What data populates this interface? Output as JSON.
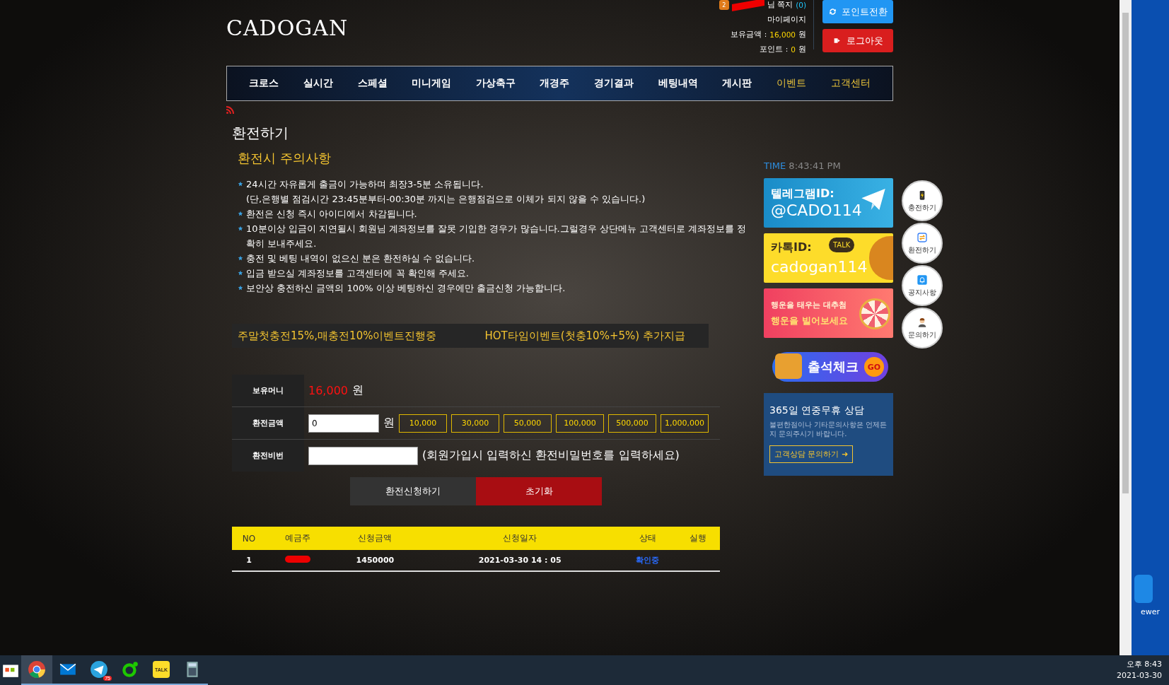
{
  "header": {
    "logo": "CADOGAN",
    "user": {
      "level": "2",
      "suffix": "님 쪽지",
      "messages": "(0)"
    },
    "mypage": "마이페이지",
    "balance": {
      "label": "보유금액 : ",
      "value": "16,000",
      "unit": "원"
    },
    "points": {
      "label": "포인트 : ",
      "value": "0",
      "unit": "원"
    },
    "buttons": [
      {
        "kind": "convert",
        "label": "포인트전환"
      },
      {
        "kind": "logout",
        "label": "로그아웃"
      }
    ]
  },
  "nav": [
    {
      "label": "크로스",
      "highlighted": false
    },
    {
      "label": "실시간",
      "highlighted": false
    },
    {
      "label": "스페셜",
      "highlighted": false
    },
    {
      "label": "미니게임",
      "highlighted": false
    },
    {
      "label": "가상축구",
      "highlighted": false
    },
    {
      "label": "개경주",
      "highlighted": false
    },
    {
      "label": "경기결과",
      "highlighted": false
    },
    {
      "label": "베팅내역",
      "highlighted": false
    },
    {
      "label": "게시판",
      "highlighted": false
    },
    {
      "label": "이벤트",
      "highlighted": true
    },
    {
      "label": "고객센터",
      "highlighted": true
    }
  ],
  "page_title": "환전하기",
  "notice_title": "환전시 주의사항",
  "notices": [
    {
      "text": "24시간 자유롭게 출금이 가능하며 최장3-5분 소유됩니다.",
      "starred": true
    },
    {
      "text": "(단,은행별 점검시간 23:45분부터-00:30분 까지는 은행점검으로 이체가 되지 않을 수 있습니다.)",
      "starred": false
    },
    {
      "text": "환전은 신청 즉시 아이디에서 차감됩니다.",
      "starred": true
    },
    {
      "text": "10분이상 입금이 지연될시 회원님 계좌정보를 잘못 기입한 경우가 많습니다.그럴경우 상단메뉴 고객센터로 계좌정보를 정확히 보내주세요.",
      "starred": true
    },
    {
      "text": "충전 및 베팅 내역이 없으신 분은 환전하실 수 없습니다.",
      "starred": true
    },
    {
      "text": "입금 받으실 계좌정보를 고객센터에 꼭 확인해 주세요.",
      "starred": true
    },
    {
      "text": "보안상 충전하신 금액의 100% 이상 베팅하신 경우에만 출금신청 가능합니다.",
      "starred": true
    }
  ],
  "ticker": [
    "주말첫충전15%,매충전10%이벤트진행중",
    "HOT타임이벤트(첫충10%+5%) 추가지급"
  ],
  "form": {
    "balance": {
      "label": "보유머니",
      "value": "16,000",
      "unit": "원"
    },
    "amount": {
      "label": "환전금액",
      "value": "0",
      "unit": "원",
      "quick": [
        "10,000",
        "30,000",
        "50,000",
        "100,000",
        "500,000",
        "1,000,000"
      ]
    },
    "password": {
      "label": "환전비번",
      "hint": "(회원가입시 입력하신 환전비밀번호를 입력하세요)"
    },
    "submit": "환전신청하기",
    "reset": "초기화"
  },
  "table": {
    "columns": [
      "NO",
      "예금주",
      "신청금액",
      "신청일자",
      "상태",
      "실행"
    ],
    "rows": [
      {
        "no": "1",
        "amount": "1450000",
        "date": "2021-03-30 14 : 05",
        "status": "확인중"
      }
    ]
  },
  "sidebar": {
    "time_label": "TIME",
    "time": "8:43:41 PM",
    "telegram": {
      "title": "텔레그램ID:",
      "id": "@CADO114"
    },
    "kakao": {
      "title": "카톡ID:",
      "badge": "TALK",
      "id": "cadogan114"
    },
    "lottery": {
      "line1": "행운을 태우는 대추첨",
      "line2": "행운을 빌어보세요"
    },
    "attendance": {
      "label": "출석체크",
      "go": "GO"
    },
    "consult": {
      "title": "365일 연중무휴 상담",
      "desc": "불편한점이나 기타문의사항은 언제든지 문의주시기 바랍니다.",
      "link": "고객상담 문의하기 ➜"
    }
  },
  "quick_menu": [
    {
      "kind": "charge",
      "label": "충전하기"
    },
    {
      "kind": "exchange",
      "label": "환전하기"
    },
    {
      "kind": "notice",
      "label": "공지사항"
    },
    {
      "kind": "inquiry",
      "label": "문의하기"
    }
  ],
  "desktop": {
    "label": "ewer"
  },
  "taskbar": {
    "apps": [
      {
        "kind": "store",
        "selected": false
      },
      {
        "kind": "chrome",
        "selected": true
      },
      {
        "kind": "mail",
        "selected": false
      },
      {
        "kind": "telegram",
        "selected": false,
        "badge": "75"
      },
      {
        "kind": "green",
        "selected": false
      },
      {
        "kind": "kakao",
        "selected": false,
        "text": "TALK"
      },
      {
        "kind": "calc",
        "selected": false
      }
    ],
    "time": "오후 8:43",
    "date": "2021-03-30"
  }
}
